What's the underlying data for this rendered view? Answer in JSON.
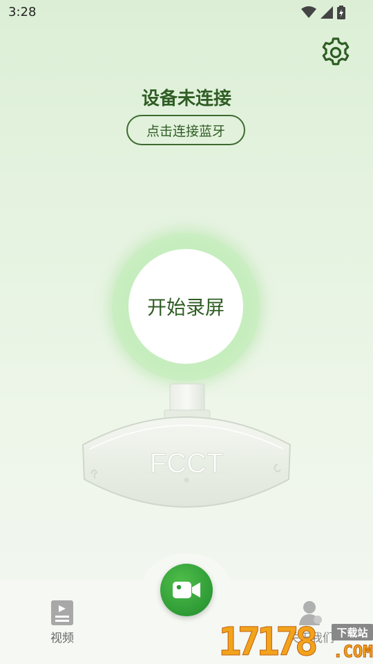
{
  "status_bar": {
    "time": "3:28",
    "icons": [
      "wifi-icon",
      "cellular-signal-icon",
      "battery-charging-icon"
    ]
  },
  "header": {
    "settings_icon": "gear-icon",
    "device_status": "设备未连接",
    "connect_label": "点击连接蓝牙"
  },
  "main": {
    "record_label": "开始录屏",
    "device_logo": "FCCT"
  },
  "bottom_nav": {
    "video_label": "视频",
    "about_label": "关于我们",
    "record_fab_icon": "video-camera-icon"
  },
  "watermark": {
    "digits": "17178",
    "badge": "下载站",
    "suffix": ".COM"
  },
  "colors": {
    "accent_green": "#2e9b35",
    "text_green": "#2f5d24",
    "glow_green": "#c6edbe"
  }
}
